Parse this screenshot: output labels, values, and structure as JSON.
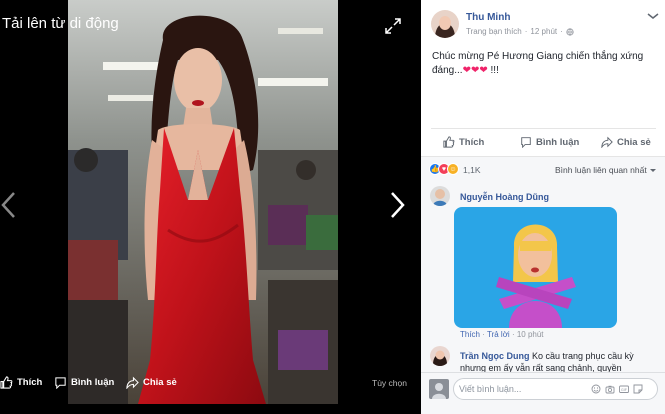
{
  "theater": {
    "album_title": "Tải lên từ di động",
    "like_label": "Thích",
    "comment_label": "Bình luận",
    "share_label": "Chia sẻ",
    "options_label": "Tùy chọn"
  },
  "post": {
    "author": "Thu Minh",
    "meta_prefix": "Trang bạn thích",
    "meta_time": "12 phút",
    "text_line1": "Chúc mừng Pé Hương Giang chiến thắng xứng",
    "text_line2": "đáng...",
    "hearts": "❤❤❤",
    "text_suffix": " !!!",
    "actions": {
      "like": "Thích",
      "comment": "Bình luận",
      "share": "Chia sẻ"
    }
  },
  "feedback": {
    "reaction_count": "1,1K",
    "sort_label": "Bình luận liên quan nhất",
    "comments": [
      {
        "name": "Nguyễn Hoàng Dũng",
        "like": "Thích",
        "reply": "Trả lời",
        "time": "10 phút"
      },
      {
        "name": "Trần Ngọc Dung",
        "text1": "Ko cầu trang phục cầu kỳ",
        "text2": "nhưng em ấy vẫn rất sang chảnh, quyền"
      }
    ],
    "composer_placeholder": "Viết bình luận..."
  },
  "colors": {
    "link_blue": "#365899",
    "dress_red": "#d11620",
    "panel_gray": "#f6f7f9",
    "gif_bg": "#2aa5e6"
  }
}
